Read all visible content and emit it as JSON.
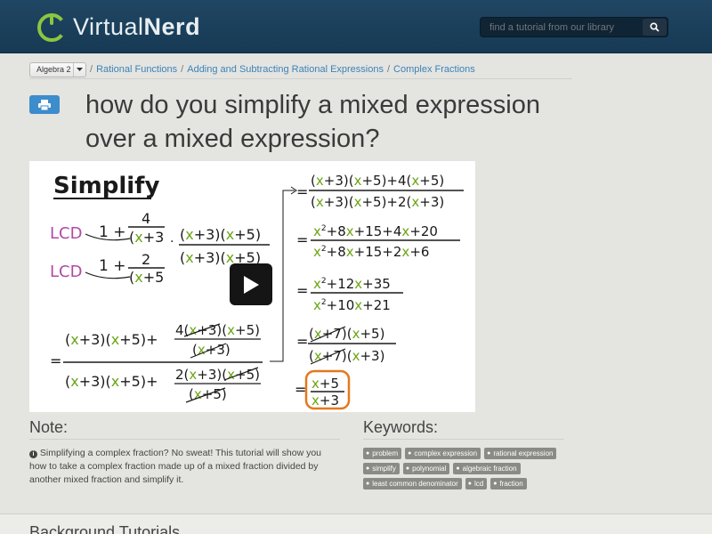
{
  "header": {
    "logo_text_light": "Virtual",
    "logo_text_bold": "Nerd",
    "search_placeholder": "find a tutorial from our library"
  },
  "breadcrumb": {
    "course": "Algebra 2",
    "items": [
      "Rational Functions",
      "Adding and Subtracting Rational Expressions",
      "Complex Fractions"
    ]
  },
  "page": {
    "title": "how do you simplify a mixed expression over a mixed expression?"
  },
  "video": {
    "heading": "Simplify",
    "lcd_label": "LCD",
    "colors": {
      "x": "#6aa513",
      "lcd": "#b24aa4",
      "box": "#e3781e",
      "ink": "#1a1a1a"
    }
  },
  "note": {
    "heading": "Note:",
    "body": "Simplifying a complex fraction? No sweat! This tutorial will show you how to take a complex fraction made up of a mixed fraction divided by another mixed fraction and simplify it."
  },
  "keywords": {
    "heading": "Keywords:",
    "tags": [
      "problem",
      "complex expression",
      "rational expression",
      "simplify",
      "polynomial",
      "algebraic fraction",
      "least common denominator",
      "lcd",
      "fraction"
    ]
  },
  "background": {
    "heading": "Background Tutorials"
  }
}
